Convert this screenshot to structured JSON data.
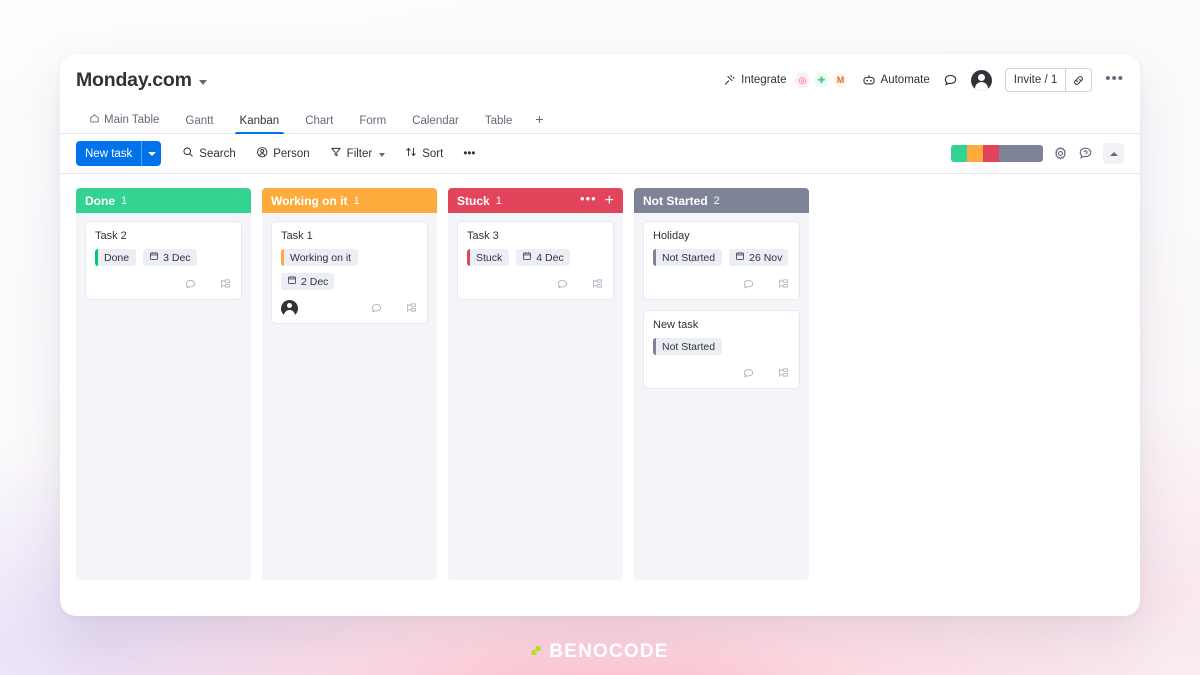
{
  "brand": {
    "text": "BENOCODE",
    "mark_color": "#b8dc36"
  },
  "topbar": {
    "board_title": "Monday.com",
    "integrate_label": "Integrate",
    "integrate_apps": [
      "dribbble",
      "slack",
      "gmail"
    ],
    "automate_label": "Automate",
    "invite_label": "Invite / 1",
    "more_label": "•••"
  },
  "tabs": [
    {
      "label": "Main Table",
      "icon": "home-icon",
      "active": false
    },
    {
      "label": "Gantt",
      "icon": "",
      "active": false
    },
    {
      "label": "Kanban",
      "icon": "",
      "active": true
    },
    {
      "label": "Chart",
      "icon": "",
      "active": false
    },
    {
      "label": "Form",
      "icon": "",
      "active": false
    },
    {
      "label": "Calendar",
      "icon": "",
      "active": false
    },
    {
      "label": "Table",
      "icon": "",
      "active": false
    }
  ],
  "tab_add_label": "+",
  "toolbar": {
    "new_task_label": "New task",
    "search_label": "Search",
    "person_label": "Person",
    "filter_label": "Filter",
    "sort_label": "Sort",
    "more_label": "•••",
    "color_strip": [
      "#33d391",
      "#fdab3d",
      "#e2445c",
      "#7e8398"
    ]
  },
  "board": {
    "columns": [
      {
        "title": "Done",
        "count": "1",
        "color": "#33d391",
        "show_actions": false,
        "dots_label": "•••",
        "plus_label": "+",
        "cards": [
          {
            "title": "Task 2",
            "status": "Done",
            "status_color": "#00c875",
            "date": "3 Dec",
            "has_avatar": false
          }
        ]
      },
      {
        "title": "Working on it",
        "count": "1",
        "color": "#fdab3d",
        "show_actions": false,
        "dots_label": "•••",
        "plus_label": "+",
        "cards": [
          {
            "title": "Task 1",
            "status": "Working on it",
            "status_color": "#fdab3d",
            "date": "2 Dec",
            "has_avatar": true
          }
        ]
      },
      {
        "title": "Stuck",
        "count": "1",
        "color": "#e2445c",
        "show_actions": true,
        "dots_label": "•••",
        "plus_label": "+",
        "cards": [
          {
            "title": "Task 3",
            "status": "Stuck",
            "status_color": "#e2445c",
            "date": "4 Dec",
            "has_avatar": false
          }
        ]
      },
      {
        "title": "Not Started",
        "count": "2",
        "color": "#7e8398",
        "show_actions": false,
        "dots_label": "•••",
        "plus_label": "+",
        "cards": [
          {
            "title": "Holiday",
            "status": "Not Started",
            "status_color": "#7e8398",
            "date": "26 Nov",
            "has_avatar": false
          },
          {
            "title": "New task",
            "status": "Not Started",
            "status_color": "#7e8398",
            "date": "",
            "has_avatar": false
          }
        ]
      }
    ]
  }
}
